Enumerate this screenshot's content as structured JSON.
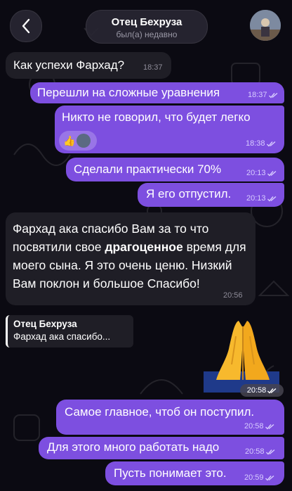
{
  "header": {
    "title": "Отец Бехруза",
    "status": "был(а) недавно"
  },
  "messages": [
    {
      "text": "Как успехи Фархад?",
      "time": "18:37",
      "dir": "in"
    },
    {
      "text": "Перешли на сложные уравнения",
      "time": "18:37",
      "dir": "out"
    },
    {
      "text": "Никто не говорил, что будет легко",
      "time": "18:38",
      "dir": "out",
      "reaction": "👍"
    },
    {
      "text": "Сделали практически 70%",
      "time": "20:13",
      "dir": "out"
    },
    {
      "text": "Я его отпустил.",
      "time": "20:13",
      "dir": "out"
    },
    {
      "text_before": "Фархад ака спасибо Вам за то что посвятили свое ",
      "text_bold": "драгоценное",
      "text_after": " время для моего сына. Я это очень ценю. Низкий Вам поклон и большое Спасибо!",
      "time": "20:56",
      "dir": "in"
    },
    {
      "reply_author": "Отец Бехруза",
      "reply_text": "Фархад ака спасибо...",
      "sticker": "🙏",
      "time": "20:58",
      "dir": "out"
    },
    {
      "text": "Самое главное, чтоб он поступил.",
      "time": "20:58",
      "dir": "out"
    },
    {
      "text": "Для этого много работать надо",
      "time": "20:58",
      "dir": "out"
    },
    {
      "text": "Пусть понимает это.",
      "time": "20:59",
      "dir": "out"
    }
  ],
  "icons": {
    "back": "chevron-left-icon",
    "read": "double-check-icon"
  },
  "colors": {
    "outgoing": "#7d4fe0",
    "incoming": "#1f1e26",
    "background": "#0b0a12"
  }
}
